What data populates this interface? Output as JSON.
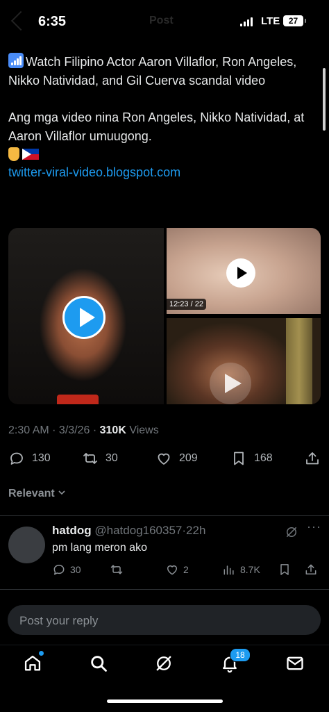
{
  "status_bar": {
    "time": "6:35",
    "network": "LTE",
    "battery": "27"
  },
  "header": {
    "title": "Post"
  },
  "tweet": {
    "text_line1": "Watch Filipino Actor Aaron Villaflor, Ron Angeles, Nikko Natividad, and Gil Cuerva scandal video",
    "text_line2": "Ang mga video nina Ron Angeles, Nikko Natividad, at Aaron Villaflor umuugong.",
    "link": "twitter-viral-video.blogspot.com",
    "media": {
      "video_duration": "12:23 / 22"
    },
    "time": "2:30 AM",
    "date": "3/3/26",
    "views_count": "310K",
    "views_label": "Views",
    "replies": "130",
    "reposts": "30",
    "likes": "209",
    "bookmarks": "168"
  },
  "sort": {
    "label": "Relevant"
  },
  "replies": [
    {
      "display_name": "hatdog",
      "handle": "@hatdog160357",
      "age": "22h",
      "text": "pm lang meron ako",
      "reply_count": "30",
      "like_count": "2",
      "view_count": "8.7K"
    }
  ],
  "composer": {
    "placeholder": "Post your reply"
  },
  "tabbar": {
    "notifications_badge": "18"
  },
  "colors": {
    "accent": "#1d9bf0",
    "background": "#000000",
    "muted": "#71767b"
  }
}
